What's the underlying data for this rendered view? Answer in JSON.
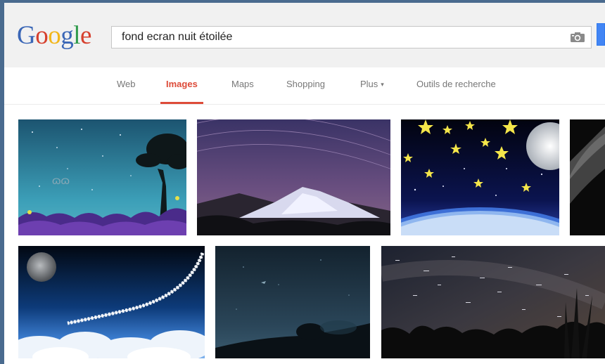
{
  "logo": {
    "letters": [
      "G",
      "o",
      "o",
      "g",
      "l",
      "e"
    ],
    "colors": [
      "#3a66b6",
      "#d6402e",
      "#f2b619",
      "#3a66b6",
      "#2f9a4b",
      "#d6402e"
    ]
  },
  "search": {
    "query": "fond ecran nuit étoilée",
    "camera_icon": "camera-icon"
  },
  "nav": {
    "tabs": [
      {
        "label": "Web",
        "active": false
      },
      {
        "label": "Images",
        "active": true
      },
      {
        "label": "Maps",
        "active": false
      },
      {
        "label": "Shopping",
        "active": false
      },
      {
        "label": "Plus",
        "active": false,
        "icon": "caret-down-icon"
      },
      {
        "label": "Outils de recherche",
        "active": false
      }
    ],
    "plus_caret": "▾"
  },
  "colors": {
    "accent": "#dd4b39",
    "header_bg": "#f1f1f1",
    "tab_text": "#777777",
    "search_button": "#4285f4"
  },
  "results": {
    "thumbnails": [
      "night-tree-meadow-image",
      "snowy-mountain-star-trails-image",
      "cartoon-stars-moon-planet-image",
      "dark-sky-partial-image",
      "moon-comet-clouds-image",
      "dark-hill-tree-silhouette-image",
      "milky-way-grass-image"
    ]
  }
}
